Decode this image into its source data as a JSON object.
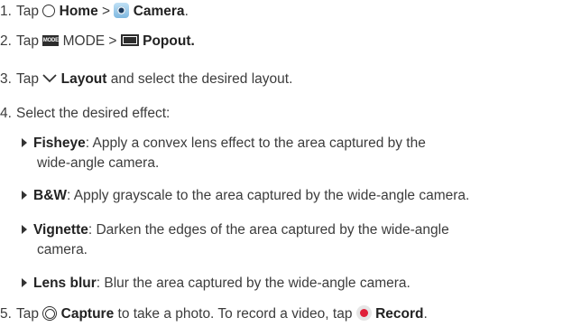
{
  "steps": [
    {
      "num": "1.",
      "t1": "Tap ",
      "b1": "Home",
      "t2": " > ",
      "b2": "Camera",
      "t3": "."
    },
    {
      "num": "2.",
      "t1": "Tap ",
      "b1": "MODE",
      "t2": " > ",
      "b2": "Popout."
    },
    {
      "num": "3.",
      "t1": "Tap ",
      "b1": "Layout",
      "t2": " and select the desired layout."
    },
    {
      "num": "4.",
      "t1": "Select the desired effect:"
    },
    {
      "num": "5.",
      "t1": "Tap ",
      "b1": "Capture",
      "t2": " to take a photo. To record a video, tap ",
      "b2": "Record",
      "t3": "."
    }
  ],
  "mode_icon_text": "MODE",
  "effects": [
    {
      "name": "Fisheye",
      "text": ": Apply a convex lens effect to the area captured by the",
      "cont": "wide-angle camera."
    },
    {
      "name": "B&W",
      "text": ": Apply grayscale to the area captured by the wide-angle camera."
    },
    {
      "name": "Vignette",
      "text": ": Darken the edges of the area captured by the wide-angle",
      "cont": "camera."
    },
    {
      "name": "Lens blur",
      "text": ": Blur the area captured by the wide-angle camera."
    }
  ]
}
